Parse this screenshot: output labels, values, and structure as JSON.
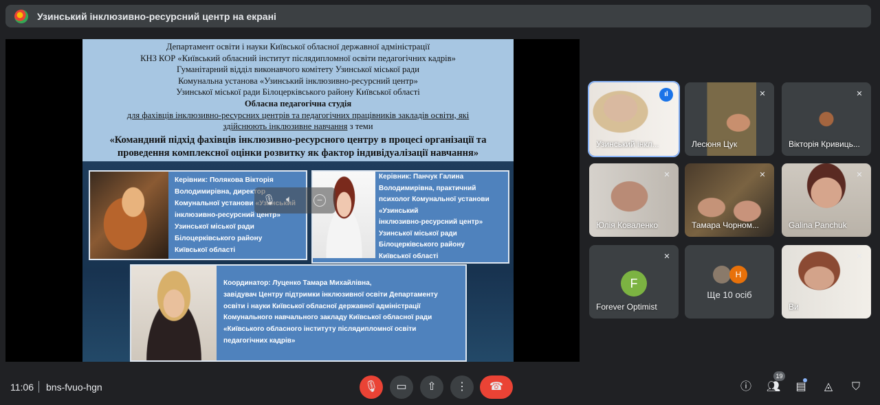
{
  "banner": {
    "title": "Узинський інклюзивно-ресурсний центр на екрані"
  },
  "slide": {
    "header_lines": [
      "Департамент освіти і науки Київської обласної державної адміністрації",
      "КНЗ КОР «Київський обласний інститут післядипломної освіти педагогічних кадрів»",
      "Гуманітарний відділ виконавчого комітету Узинської міської ради",
      "Комунальна установа «Узинський інклюзивно-ресурсний центр»",
      "Узинської міської ради Білоцерківського району Київської області"
    ],
    "studio": "Обласна  педагогічна студія",
    "audience_1": "для фахівців інклюзивно-ресурсних центрів та педагогічних працівників закладів освіти, які",
    "audience_2": "здійснюють інклюзивне навчання",
    "audience_3": " з теми",
    "topic_1": "«Командний підхід фахівців інклюзивно-ресурсного центру в процесі організації та",
    "topic_2": "проведення комплексної оцінки розвитку як фактор індивідуалізації навчання»",
    "card1": [
      "Керівник: Полякова Вікторія",
      "Володимирівна,  директор",
      "Комунальної установи «Узинський",
      "інклюзивно-ресурсний центр»",
      "Узинської міської ради",
      "Білоцерківського району",
      "Київської області"
    ],
    "card2": [
      "Керівник: Панчук Галина",
      "Володимирівна,  практичний",
      "психолог Комунальної установи",
      "«Узинський",
      "інклюзивно-ресурсний центр»",
      "Узинської міської ради",
      "Білоцерківського району",
      "Київської області"
    ],
    "card3": [
      "Координатор: Луценко Тамара Михайлівна,",
      "завідувач Центру підтримки інклюзивної освіти Департаменту",
      "освіти і науки Київської обласної державної адміністрації",
      "Комунального навчального закладу Київської обласної ради",
      "«Київського обласного інституту післядипломної освіти",
      "педагогічних кадрів»"
    ]
  },
  "tiles": [
    {
      "name": "Узинський інклюзивно-ресурсний центр",
      "display": "Узинський інкл...",
      "speaking": true
    },
    {
      "name": "Лесюня Цук",
      "muted": true
    },
    {
      "name": "Вікторія Кривиць...",
      "muted": true
    },
    {
      "name": "Юлія Коваленко",
      "muted": true
    },
    {
      "name": "Тамара Чорном...",
      "muted": true
    },
    {
      "name": "Galina Panchuk",
      "muted": true
    },
    {
      "name": "Forever Optimist",
      "initial": "F",
      "muted": true
    },
    {
      "name": "Ще 10 осіб",
      "initial": "Н"
    },
    {
      "name": "Ви",
      "muted": true
    }
  ],
  "bottom": {
    "time": "11:06",
    "meeting_code": "bns-fvuo-hgn",
    "participants_count": "19"
  },
  "icons": {
    "mic_off": "mic-off-icon",
    "camera": "camera-icon",
    "present": "present-screen-icon",
    "more": "more-vertical-icon",
    "hangup": "hangup-icon",
    "info": "info-icon",
    "people": "people-icon",
    "chat": "chat-icon",
    "activities": "activities-icon",
    "host": "host-controls-icon"
  },
  "colors": {
    "bg": "#202124",
    "surface": "#3c4043",
    "red": "#ea4335",
    "accent": "#8ab4f8"
  }
}
